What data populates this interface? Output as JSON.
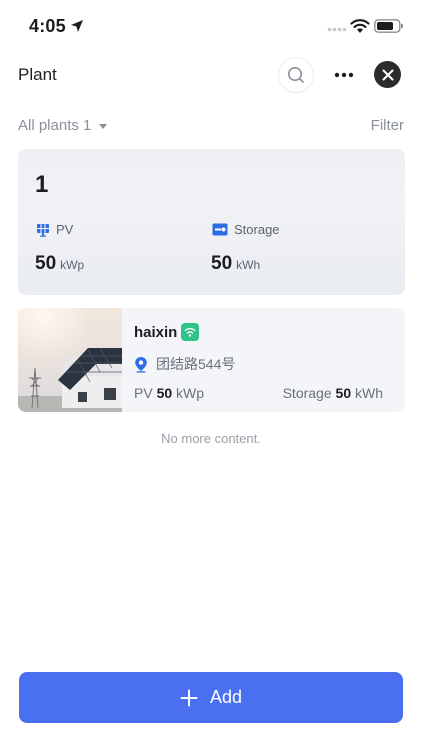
{
  "status_bar": {
    "time": "4:05",
    "icons": [
      "location-arrow-icon",
      "signal-dots-icon",
      "wifi-icon",
      "battery-icon"
    ]
  },
  "header": {
    "title": "Plant",
    "actions": [
      "search-icon",
      "more-icon",
      "close-icon"
    ]
  },
  "filter": {
    "all_plants": "All plants 1",
    "filter_label": "Filter"
  },
  "summary": {
    "count": "1",
    "pv_label": "PV",
    "pv_value": "50",
    "pv_unit": "kWp",
    "storage_label": "Storage",
    "storage_value": "50",
    "storage_unit": "kWh"
  },
  "plants": [
    {
      "name": "haixin",
      "status": "online",
      "address": "团结路544号",
      "pv_label": "PV",
      "pv_value": "50",
      "pv_unit": "kWp",
      "storage_label": "Storage",
      "storage_value": "50",
      "storage_unit": "kWh"
    }
  ],
  "list_end_text": "No more content.",
  "add_button": {
    "label": "Add"
  },
  "colors": {
    "accent": "#4a6ff0",
    "online": "#2fc38a",
    "icon_blue": "#2f6de6",
    "text_secondary": "#8a8f99"
  }
}
